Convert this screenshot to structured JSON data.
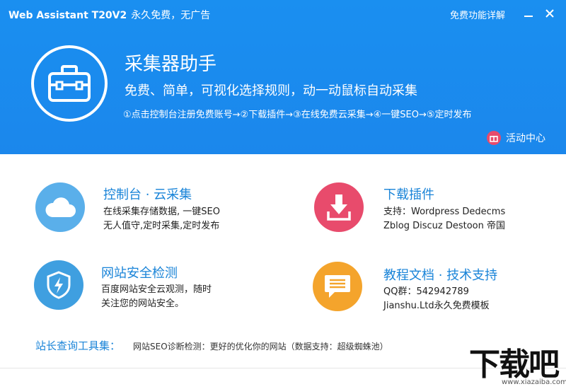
{
  "titlebar": {
    "app_name": "Web Assistant T20V2",
    "slogan": "永久免费，无广告",
    "features_link": "免费功能详解",
    "minimize_glyph": "—",
    "close_glyph": "✕"
  },
  "hero": {
    "title": "采集器助手",
    "subtitle": "免费、简单，可视化选择规则，动一动鼠标自动采集",
    "steps": "①点击控制台注册免费账号→②下载插件→③在线免费云采集→④一键SEO→⑤定时发布",
    "activity_label": "活动中心",
    "logo_icon": "toolbox-icon"
  },
  "cards": [
    {
      "title": "控制台 · 云采集",
      "desc_line1": "在线采集存储数据, 一键SEO",
      "desc_line2": "无人值守,定时采集,定时发布",
      "icon": "cloud-icon",
      "color": "#5aafea"
    },
    {
      "title": "下载插件",
      "desc_line1": "支持：Wordpress Dedecms",
      "desc_line2": "Zblog Discuz Destoon 帝国",
      "icon": "download-icon",
      "color": "#e84b6c"
    },
    {
      "title": "网站安全检测",
      "desc_line1": "百度网站安全云观测，随时",
      "desc_line2": "关注您的网站安全。",
      "icon": "shield-icon",
      "color": "#3f9fe0"
    },
    {
      "title": "教程文档 · 技术支持",
      "desc_line1": "QQ群：542942789",
      "desc_line2": "Jianshu.Ltd永久免费模板",
      "icon": "chat-bubble-icon",
      "color": "#f4a42c"
    }
  ],
  "tools": {
    "label": "站长查询工具集：",
    "text": "网站SEO诊断检测：更好的优化你的网站（数据支持：超级蜘蛛池）"
  },
  "watermark": {
    "text": "下载吧",
    "url": "www.xiazaiba.com"
  },
  "colors": {
    "header_blue": "#1a8ff0",
    "link_blue": "#1a84d8"
  }
}
